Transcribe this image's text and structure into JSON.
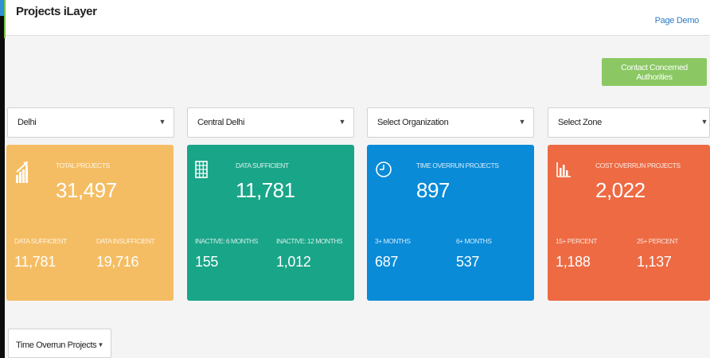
{
  "header": {
    "title": "Projects iLayer",
    "page_demo_link": "Page Demo"
  },
  "actions": {
    "contact_button": "Contact Concerned Authorities"
  },
  "filters": {
    "state": "Delhi",
    "district": "Central Delhi",
    "organization": "Select Organization",
    "zone": "Select Zone"
  },
  "cards": [
    {
      "label": "TOTAL PROJECTS",
      "value": "31,497",
      "icon": "growth-chart-icon",
      "sub": [
        {
          "label": "DATA SUFFICIENT",
          "value": "11,781"
        },
        {
          "label": "DATA INSUFFICIENT",
          "value": "19,716"
        }
      ],
      "color": "#f5bd63"
    },
    {
      "label": "DATA SUFFICIENT",
      "value": "11,781",
      "icon": "grid-icon",
      "sub": [
        {
          "label": "INACTIVE: 6 MONTHS",
          "value": "155"
        },
        {
          "label": "INACTIVE: 12 MONTHS",
          "value": "1,012"
        }
      ],
      "color": "#19a588"
    },
    {
      "label": "TIME OVERRUN PROJECTS",
      "value": "897",
      "icon": "clock-icon",
      "sub": [
        {
          "label": "3+ MONTHS",
          "value": "687"
        },
        {
          "label": "6+ MONTHS",
          "value": "537"
        }
      ],
      "color": "#098bd8"
    },
    {
      "label": "COST OVERRUN PROJECTS",
      "value": "2,022",
      "icon": "bar-chart-icon",
      "sub": [
        {
          "label": "15+ PERCENT",
          "value": "1,188"
        },
        {
          "label": "25+ PERCENT",
          "value": "1,137"
        }
      ],
      "color": "#ed6a43"
    }
  ],
  "bottom": {
    "view_select": "Time Overrun Projects"
  },
  "colors": {
    "accent_button": "#8bc863",
    "link": "#2e7dc4"
  }
}
